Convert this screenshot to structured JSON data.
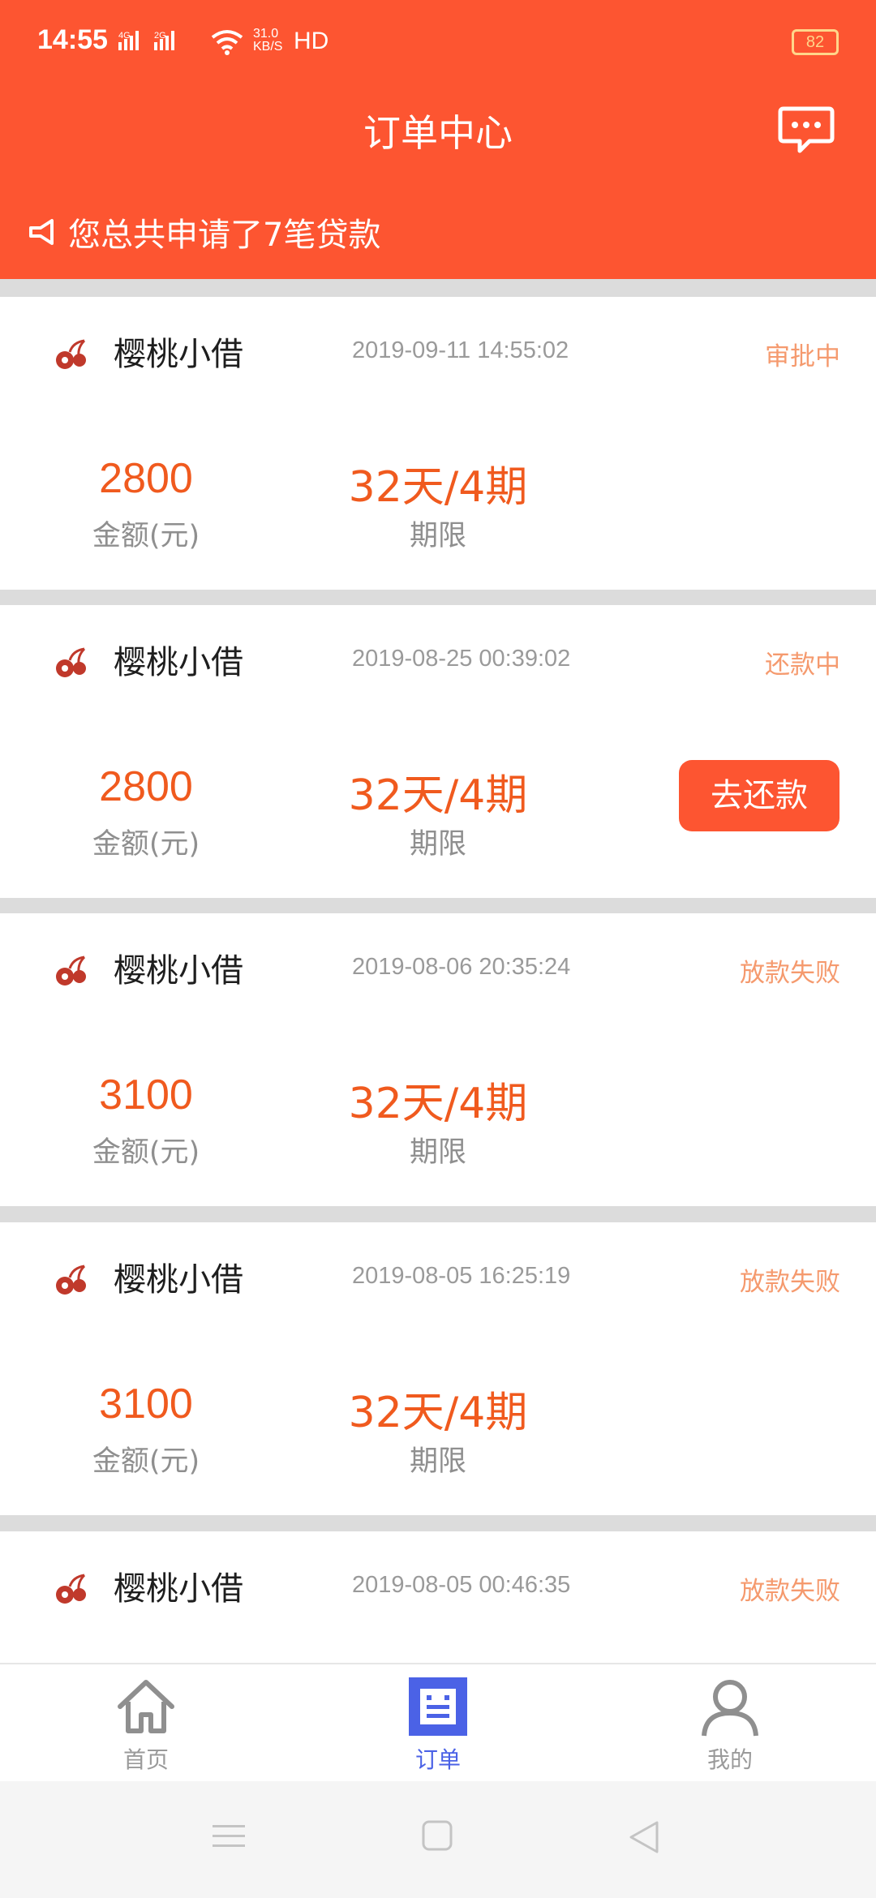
{
  "status_bar": {
    "time": "14:55",
    "signal": "4G 2G",
    "net_speed_value": "31.0",
    "net_speed_unit": "KB/S",
    "hd": "HD",
    "battery": "82"
  },
  "header": {
    "title": "订单中心",
    "message_icon": "chat-bubble-icon",
    "notice_icon": "megaphone-icon",
    "notice_text": "您总共申请了7笔贷款"
  },
  "orders": [
    {
      "name": "樱桃小借",
      "date": "2019-09-11 14:55:02",
      "status": "审批中",
      "amount": "2800",
      "amount_label": "金额(元)",
      "term": "32天/4期",
      "term_label": "期限",
      "action": ""
    },
    {
      "name": "樱桃小借",
      "date": "2019-08-25 00:39:02",
      "status": "还款中",
      "amount": "2800",
      "amount_label": "金额(元)",
      "term": "32天/4期",
      "term_label": "期限",
      "action": "去还款"
    },
    {
      "name": "樱桃小借",
      "date": "2019-08-06 20:35:24",
      "status": "放款失败",
      "amount": "3100",
      "amount_label": "金额(元)",
      "term": "32天/4期",
      "term_label": "期限",
      "action": ""
    },
    {
      "name": "樱桃小借",
      "date": "2019-08-05 16:25:19",
      "status": "放款失败",
      "amount": "3100",
      "amount_label": "金额(元)",
      "term": "32天/4期",
      "term_label": "期限",
      "action": ""
    },
    {
      "name": "樱桃小借",
      "date": "2019-08-05 00:46:35",
      "status": "放款失败",
      "amount": "",
      "amount_label": "",
      "term": "",
      "term_label": "",
      "action": ""
    }
  ],
  "tabbar": {
    "home": "首页",
    "orders": "订单",
    "mine": "我的",
    "active": "orders"
  },
  "colors": {
    "brand": "#fd5531",
    "amount": "#f05a1e",
    "status": "#f59a6e",
    "tab_active": "#4b62e6"
  }
}
